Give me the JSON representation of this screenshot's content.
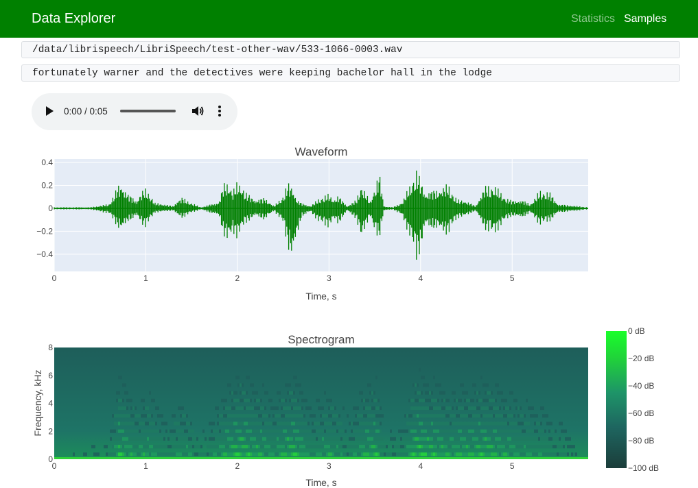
{
  "navbar": {
    "brand": "Data Explorer",
    "links": [
      {
        "label": "Statistics",
        "active": false
      },
      {
        "label": "Samples",
        "active": true
      }
    ],
    "color": "#008000"
  },
  "sample": {
    "path": "/data/librispeech/LibriSpeech/test-other-wav/533-1066-0003.wav",
    "transcript": "fortunately warner and the detectives were keeping bachelor hall in the lodge"
  },
  "player": {
    "time": "0:00 / 0:05",
    "icons": [
      "play-icon",
      "volume-icon",
      "more-options-icon"
    ]
  },
  "chart_data": [
    {
      "type": "line",
      "title": "Waveform",
      "xlabel": "Time, s",
      "ylabel": "",
      "xlim": [
        0,
        5.83
      ],
      "ylim": [
        -0.55,
        0.43
      ],
      "x_ticks": [
        "0",
        "1",
        "2",
        "3",
        "4",
        "5"
      ],
      "y_ticks": [
        "0.4",
        "0.2",
        "0",
        "−0.2",
        "−0.4"
      ],
      "series": [
        {
          "color": "#008000",
          "x": [
            0.0,
            0.4,
            0.6,
            0.7,
            0.75,
            0.8,
            0.9,
            0.95,
            1.0,
            1.05,
            1.1,
            1.2,
            1.3,
            1.35,
            1.4,
            1.5,
            1.6,
            1.8,
            1.85,
            1.9,
            1.95,
            2.0,
            2.05,
            2.1,
            2.2,
            2.3,
            2.4,
            2.5,
            2.55,
            2.6,
            2.65,
            2.7,
            2.8,
            2.9,
            3.0,
            3.05,
            3.1,
            3.2,
            3.3,
            3.35,
            3.4,
            3.45,
            3.5,
            3.55,
            3.6,
            3.7,
            3.8,
            3.9,
            3.95,
            4.0,
            4.05,
            4.1,
            4.2,
            4.3,
            4.4,
            4.5,
            4.6,
            4.7,
            4.8,
            4.9,
            5.0,
            5.1,
            5.2,
            5.3,
            5.4,
            5.5,
            5.83
          ],
          "y_max": [
            0.01,
            0.01,
            0.04,
            0.21,
            0.22,
            0.14,
            0.07,
            0.15,
            0.18,
            0.13,
            0.05,
            0.04,
            0.02,
            0.08,
            0.1,
            0.05,
            0.01,
            0.06,
            0.23,
            0.25,
            0.16,
            0.24,
            0.22,
            0.14,
            0.08,
            0.1,
            0.02,
            0.12,
            0.23,
            0.2,
            0.08,
            0.05,
            0.02,
            0.1,
            0.13,
            0.08,
            0.12,
            0.02,
            0.08,
            0.23,
            0.14,
            0.06,
            0.2,
            0.33,
            0.02,
            0.01,
            0.06,
            0.24,
            0.37,
            0.26,
            0.14,
            0.16,
            0.18,
            0.22,
            0.08,
            0.07,
            0.02,
            0.2,
            0.22,
            0.12,
            0.07,
            0.08,
            0.04,
            0.16,
            0.16,
            0.04,
            0.01
          ],
          "y_min": [
            -0.01,
            -0.01,
            -0.05,
            -0.18,
            -0.2,
            -0.13,
            -0.07,
            -0.14,
            -0.17,
            -0.11,
            -0.04,
            -0.03,
            -0.02,
            -0.07,
            -0.09,
            -0.04,
            -0.01,
            -0.07,
            -0.25,
            -0.32,
            -0.22,
            -0.27,
            -0.2,
            -0.13,
            -0.07,
            -0.11,
            -0.02,
            -0.14,
            -0.35,
            -0.46,
            -0.27,
            -0.08,
            -0.03,
            -0.14,
            -0.17,
            -0.1,
            -0.15,
            -0.02,
            -0.1,
            -0.3,
            -0.16,
            -0.07,
            -0.24,
            -0.28,
            -0.02,
            -0.01,
            -0.07,
            -0.3,
            -0.5,
            -0.38,
            -0.16,
            -0.18,
            -0.2,
            -0.24,
            -0.09,
            -0.07,
            -0.02,
            -0.19,
            -0.25,
            -0.13,
            -0.07,
            -0.09,
            -0.04,
            -0.15,
            -0.13,
            -0.04,
            -0.01
          ]
        }
      ]
    },
    {
      "type": "heatmap",
      "title": "Spectrogram",
      "xlabel": "Time, s",
      "ylabel": "Frequency, kHz",
      "xlim": [
        0,
        5.83
      ],
      "ylim": [
        0,
        8
      ],
      "x_ticks": [
        "0",
        "1",
        "2",
        "3",
        "4",
        "5"
      ],
      "y_ticks": [
        "8",
        "6",
        "4",
        "2",
        "0"
      ],
      "colorbar": {
        "ticks": [
          "0 dB",
          "−20 dB",
          "−40 dB",
          "−60 dB",
          "−80 dB",
          "−100 dB"
        ],
        "range": [
          -100,
          0
        ],
        "colors": [
          "#1b3d3a",
          "#1e6660",
          "#1e9468",
          "#20d23a",
          "#19ff2a"
        ]
      },
      "energy": {
        "t": [
          0.0,
          0.6,
          0.7,
          0.8,
          0.9,
          1.0,
          1.2,
          1.4,
          1.6,
          1.8,
          2.0,
          2.2,
          2.4,
          2.6,
          2.8,
          3.0,
          3.2,
          3.4,
          3.5,
          3.6,
          3.8,
          3.95,
          4.1,
          4.3,
          4.5,
          4.7,
          4.9,
          5.1,
          5.3,
          5.5,
          5.83
        ],
        "level": [
          0.1,
          0.2,
          0.8,
          0.6,
          0.5,
          0.6,
          0.3,
          0.5,
          0.2,
          0.5,
          0.9,
          0.7,
          0.5,
          0.9,
          0.4,
          0.6,
          0.3,
          0.7,
          0.8,
          0.2,
          0.3,
          1.0,
          0.8,
          0.6,
          0.7,
          0.8,
          0.6,
          0.5,
          0.4,
          0.3,
          0.1
        ]
      }
    }
  ]
}
